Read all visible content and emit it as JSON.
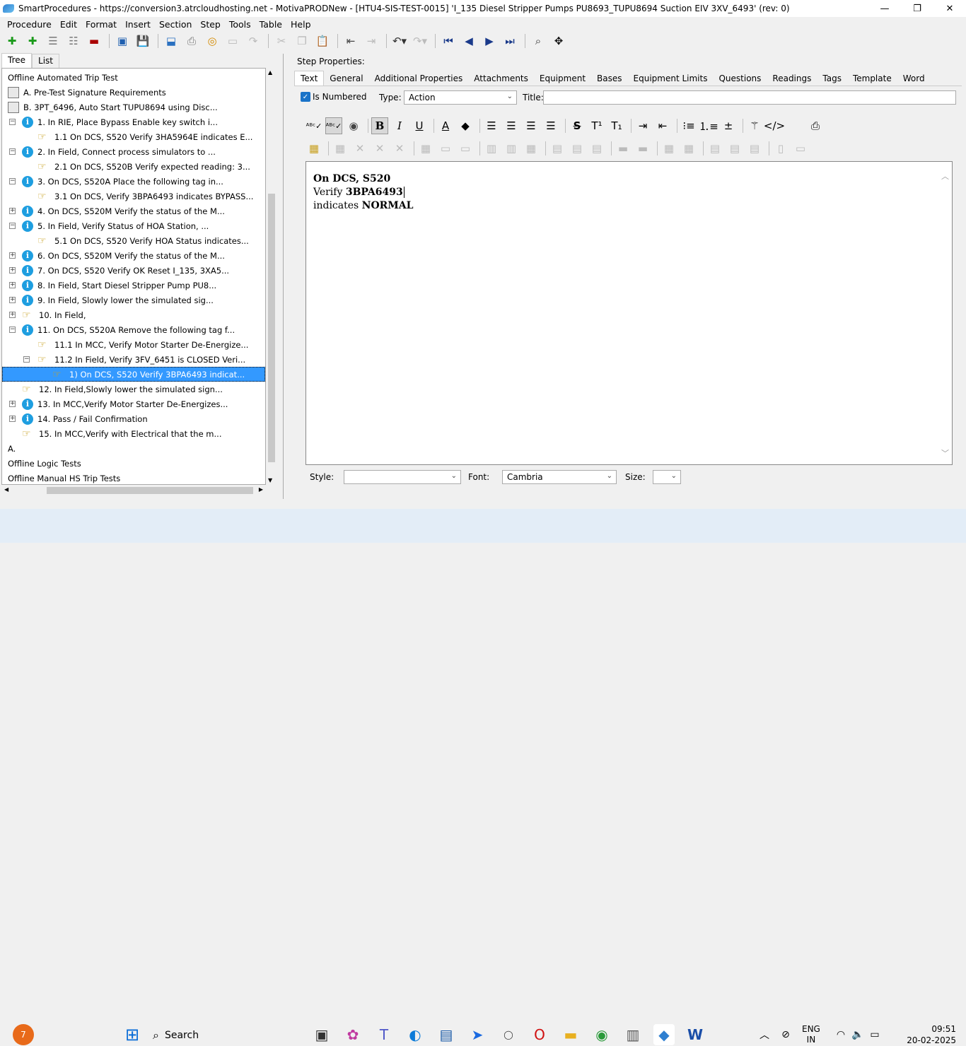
{
  "window": {
    "title": "SmartProcedures - https://conversion3.atrcloudhosting.net - MotivaPRODNew - [HTU4-SIS-TEST-0015] 'I_135 Diesel Stripper Pumps PU8693_TUPU8694 Suction EIV 3XV_6493' (rev: 0)",
    "controls": {
      "minimize": "—",
      "maximize": "❐",
      "close": "✕"
    }
  },
  "menu": [
    "Procedure",
    "Edit",
    "Format",
    "Insert",
    "Section",
    "Step",
    "Tools",
    "Table",
    "Help"
  ],
  "left_tabs": [
    "Tree",
    "List"
  ],
  "tree": [
    {
      "text": "Offline Automated Trip Test",
      "icon": "none",
      "exp": "",
      "lvl": 0
    },
    {
      "text": "A. Pre-Test Signature Requirements",
      "icon": "doc",
      "exp": "",
      "lvl": 0
    },
    {
      "text": "B. 3PT_6496, Auto Start TUPU8694 using Disc...",
      "icon": "doc",
      "exp": "",
      "lvl": 0
    },
    {
      "text": "1. In RIE, Place Bypass Enable key switch i...",
      "icon": "info",
      "exp": "−",
      "lvl": 1
    },
    {
      "text": "1.1 On DCS, S520 Verify 3HA5964E indicates E...",
      "icon": "hand",
      "exp": "",
      "lvl": 2
    },
    {
      "text": "2. In Field, Connect process simulators to ...",
      "icon": "info",
      "exp": "−",
      "lvl": 1
    },
    {
      "text": "2.1 On DCS, S520B Verify expected reading: 3...",
      "icon": "hand",
      "exp": "",
      "lvl": 2
    },
    {
      "text": "3. On DCS, S520A Place the following tag in...",
      "icon": "info",
      "exp": "−",
      "lvl": 1
    },
    {
      "text": "3.1 On DCS, Verify 3BPA6493 indicates BYPASS...",
      "icon": "hand",
      "exp": "",
      "lvl": 2
    },
    {
      "text": "4. On DCS, S520M Verify the status of the M...",
      "icon": "info",
      "exp": "+",
      "lvl": 1
    },
    {
      "text": "5. In Field, Verify Status of HOA Station, ...",
      "icon": "info",
      "exp": "−",
      "lvl": 1
    },
    {
      "text": "5.1 On DCS, S520 Verify HOA Status indicates...",
      "icon": "hand",
      "exp": "",
      "lvl": 2
    },
    {
      "text": "6. On DCS, S520M Verify the status of the M...",
      "icon": "info",
      "exp": "+",
      "lvl": 1
    },
    {
      "text": "7. On DCS, S520 Verify OK Reset I_135, 3XA5...",
      "icon": "info",
      "exp": "+",
      "lvl": 1
    },
    {
      "text": "8. In Field, Start Diesel Stripper Pump PU8...",
      "icon": "info",
      "exp": "+",
      "lvl": 1
    },
    {
      "text": "9. In Field, Slowly lower the simulated sig...",
      "icon": "info",
      "exp": "+",
      "lvl": 1
    },
    {
      "text": "10. In Field,",
      "icon": "hand",
      "exp": "+",
      "lvl": 1
    },
    {
      "text": "11. On DCS, S520A Remove the following tag f...",
      "icon": "info",
      "exp": "−",
      "lvl": 1
    },
    {
      "text": "11.1 In MCC, Verify Motor Starter De-Energize...",
      "icon": "hand",
      "exp": "",
      "lvl": 2
    },
    {
      "text": "11.2 In Field, Verify 3FV_6451 is CLOSED Veri...",
      "icon": "hand",
      "exp": "−",
      "lvl": 2
    },
    {
      "text": "1) On DCS, S520 Verify 3BPA6493    indicat...",
      "icon": "hand",
      "exp": "",
      "lvl": 3,
      "selected": true
    },
    {
      "text": "12. In Field,Slowly lower the simulated sign...",
      "icon": "hand",
      "exp": "",
      "lvl": 1
    },
    {
      "text": "13. In MCC,Verify Motor Starter De-Energizes...",
      "icon": "info",
      "exp": "+",
      "lvl": 1
    },
    {
      "text": "14. Pass / Fail Confirmation",
      "icon": "info",
      "exp": "+",
      "lvl": 1
    },
    {
      "text": "15. In MCC,Verify with Electrical that the m...",
      "icon": "hand",
      "exp": "",
      "lvl": 1
    },
    {
      "text": "A.",
      "icon": "none",
      "exp": "",
      "lvl": 0
    },
    {
      "text": "Offline Logic Tests",
      "icon": "none",
      "exp": "",
      "lvl": 0
    },
    {
      "text": "Offline Manual HS Trip Tests",
      "icon": "none",
      "exp": "",
      "lvl": 0
    }
  ],
  "step_properties_label": "Step Properties:",
  "right_tabs": [
    "Text",
    "General",
    "Additional Properties",
    "Attachments",
    "Equipment",
    "Bases",
    "Equipment Limits",
    "Questions",
    "Readings",
    "Tags",
    "Template",
    "Word"
  ],
  "form": {
    "is_numbered_label": "Is Numbered",
    "type_label": "Type:",
    "type_value": "Action",
    "title_label": "Title:",
    "title_value": ""
  },
  "editor": {
    "line1_bold": "On DCS, S520",
    "line2_prefix": "Verify ",
    "line2_bold": "3BPA6493",
    "line3_prefix": "indicates ",
    "line3_bold": "NORMAL"
  },
  "bottom": {
    "style_label": "Style:",
    "style_value": "",
    "font_label": "Font:",
    "font_value": "Cambria",
    "size_label": "Size:",
    "size_value": ""
  },
  "taskbar": {
    "search_label": "Search",
    "badge": "7",
    "lang1": "ENG",
    "lang2": "IN",
    "time": "09:51",
    "date": "20-02-2025"
  },
  "colors": {
    "selection": "#3399ff",
    "info_icon": "#1e9ee0",
    "hand_icon": "#c8a020",
    "taskbar": "#e3edf7"
  }
}
